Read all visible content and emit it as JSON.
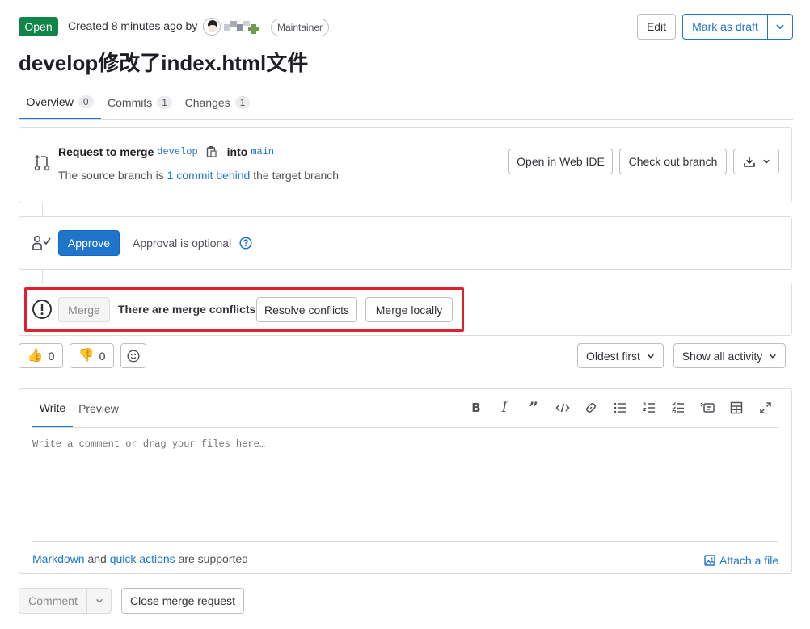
{
  "header": {
    "status_badge": "Open",
    "created_text": "Created 8 minutes ago by",
    "role_badge": "Maintainer",
    "edit_label": "Edit",
    "draft_label": "Mark as draft",
    "title": "develop修改了index.html文件"
  },
  "tabs": [
    {
      "label": "Overview",
      "count": "0"
    },
    {
      "label": "Commits",
      "count": "1"
    },
    {
      "label": "Changes",
      "count": "1"
    }
  ],
  "merge_info": {
    "request_label": "Request to merge",
    "source_branch": "develop",
    "into_label": "into",
    "target_branch": "main",
    "status_prefix": "The source branch is",
    "behind_link": "1 commit behind",
    "status_suffix": "the target branch",
    "web_ide_label": "Open in Web IDE",
    "checkout_label": "Check out branch"
  },
  "approval": {
    "approve_label": "Approve",
    "optional_text": "Approval is optional"
  },
  "merge": {
    "merge_label": "Merge",
    "conflict_text": "There are merge conflicts",
    "resolve_label": "Resolve conflicts",
    "local_label": "Merge locally"
  },
  "reactions": {
    "thumbs_up_count": "0",
    "thumbs_down_count": "0"
  },
  "filters": {
    "sort_label": "Oldest first",
    "activity_label": "Show all activity"
  },
  "editor": {
    "write_tab": "Write",
    "preview_tab": "Preview",
    "placeholder": "Write a comment or drag your files here…",
    "markdown_link": "Markdown",
    "and_text": "and",
    "quick_actions_link": "quick actions",
    "supported_text": "are supported",
    "attach_label": "Attach a file"
  },
  "footer": {
    "comment_label": "Comment",
    "close_label": "Close merge request"
  },
  "colors": {
    "accent": "#1f75cb",
    "open_badge": "#108548",
    "highlight": "#e0202a"
  }
}
